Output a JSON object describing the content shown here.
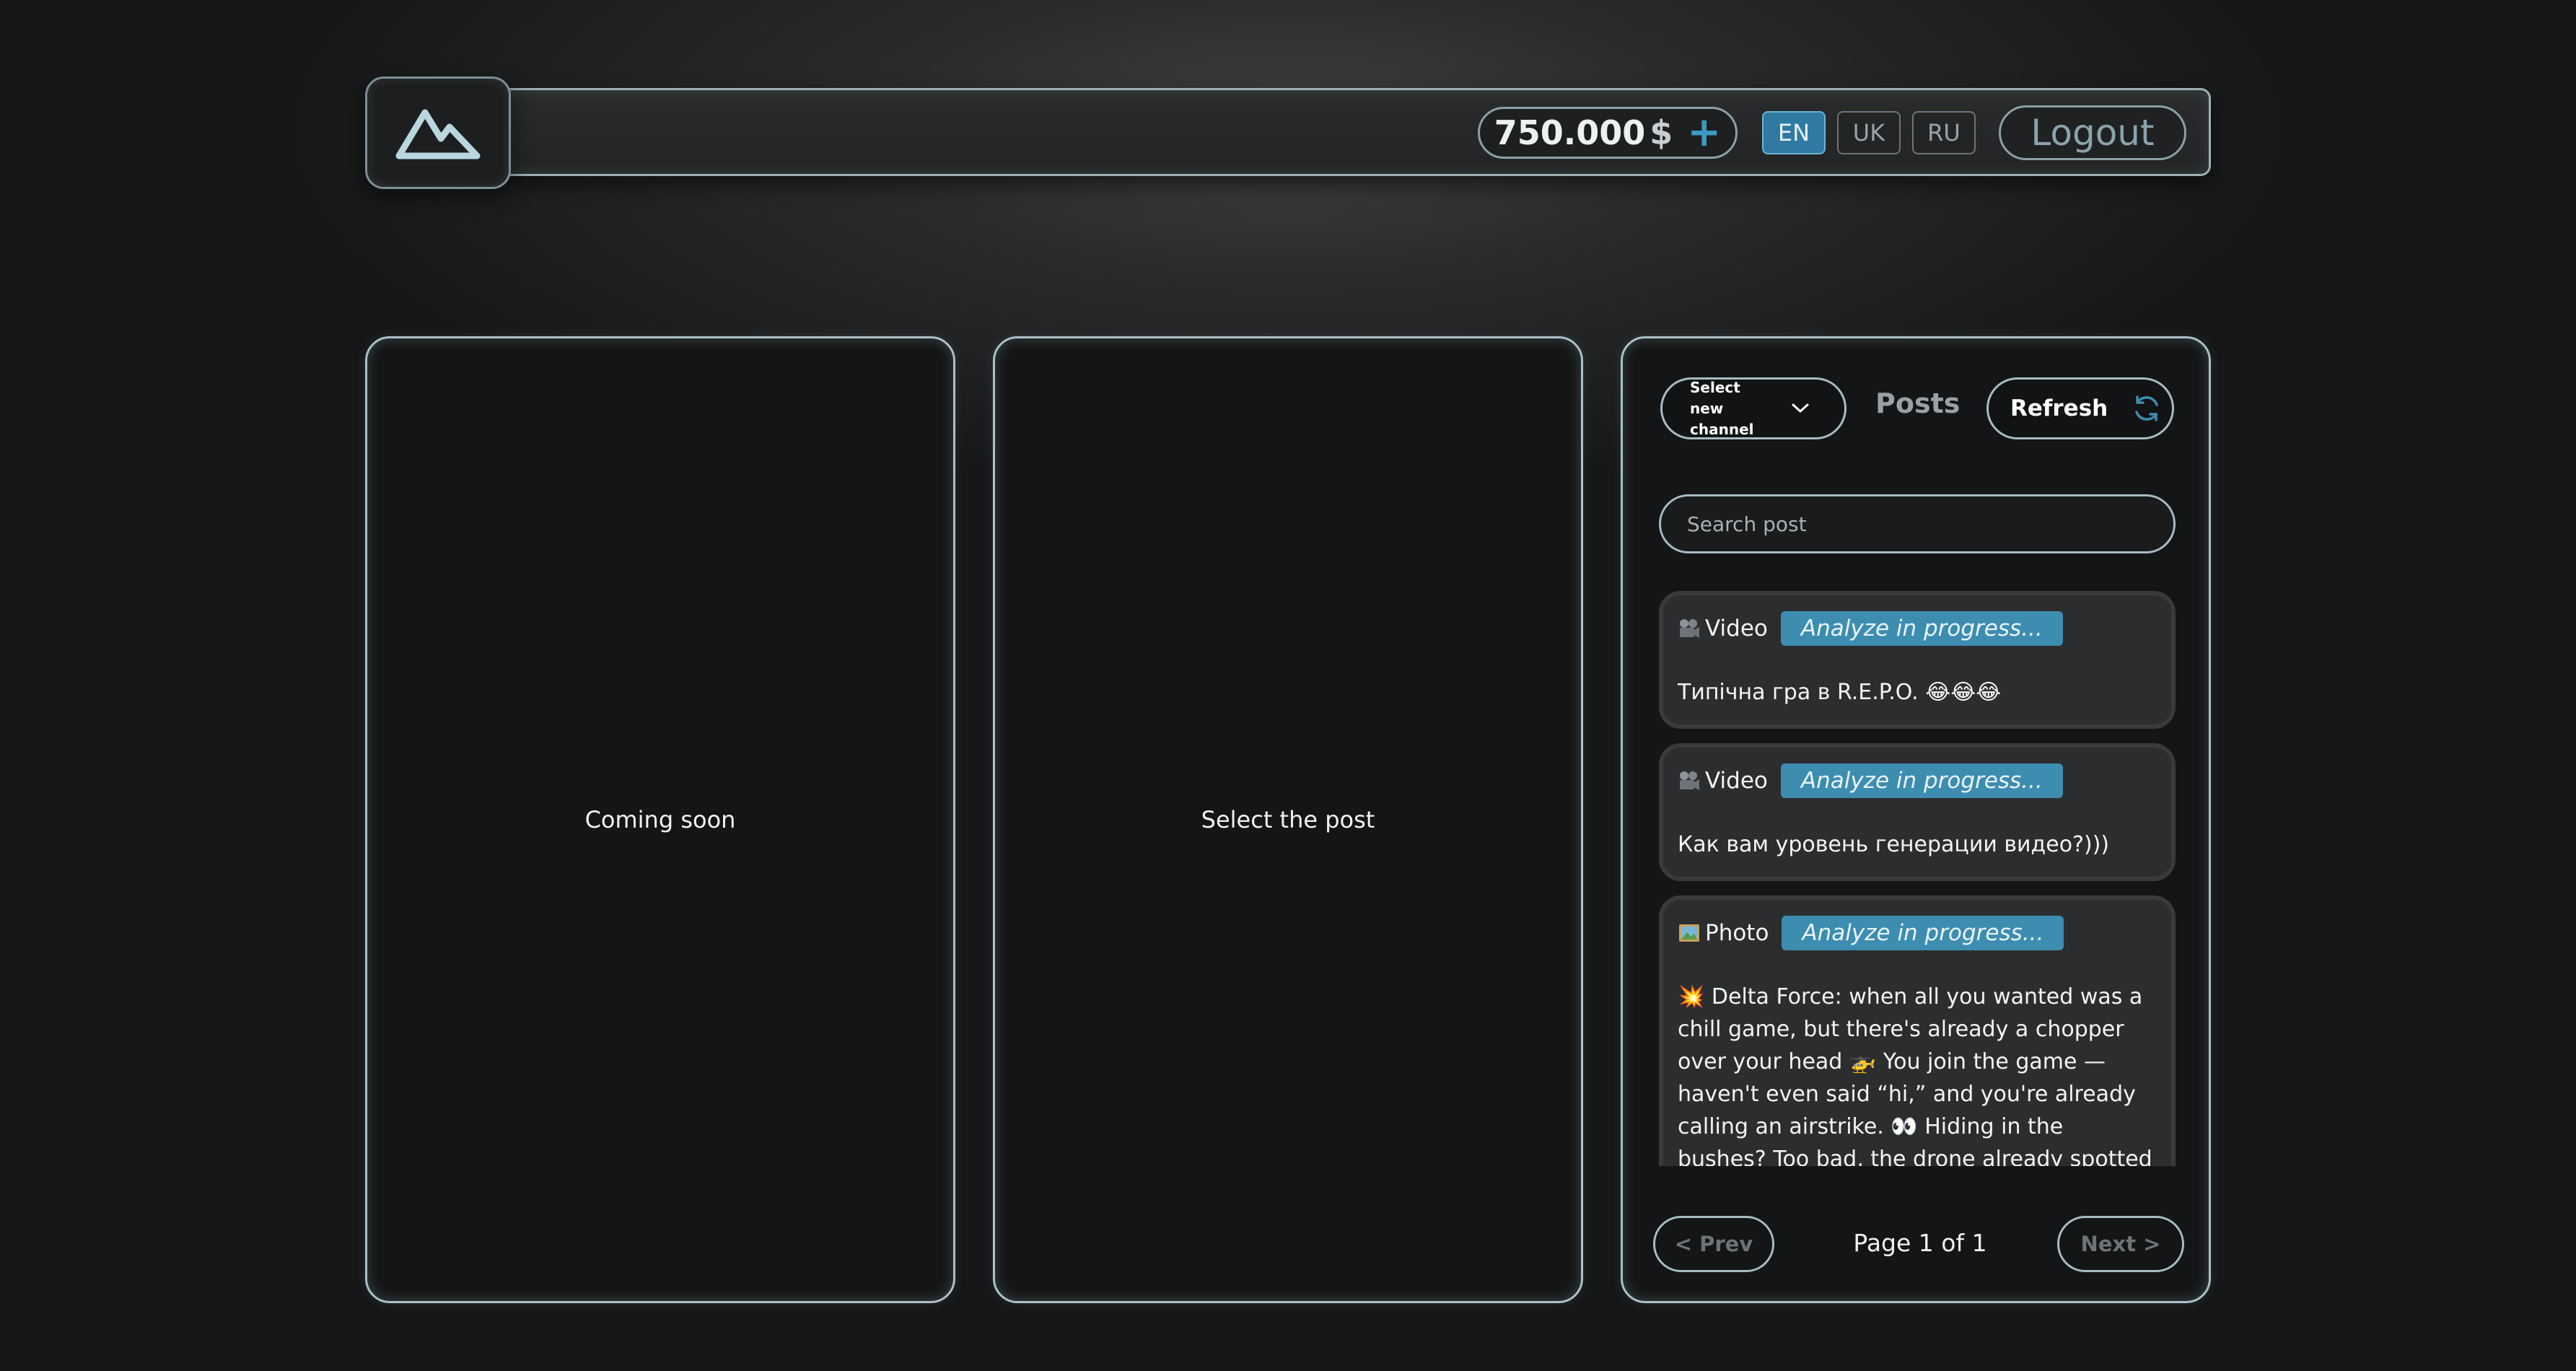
{
  "header": {
    "balance_amount": "750.000",
    "balance_currency": "$",
    "add_funds_symbol": "+",
    "languages": [
      {
        "code": "EN",
        "active": true
      },
      {
        "code": "UK",
        "active": false
      },
      {
        "code": "RU",
        "active": false
      }
    ],
    "logout_label": "Logout"
  },
  "left_panel": {
    "text": "Coming soon"
  },
  "middle_panel": {
    "text": "Select the post"
  },
  "posts_panel": {
    "channel_select_label": "Select new channel",
    "title": "Posts",
    "refresh_label": "Refresh",
    "search_placeholder": "Search post",
    "posts": [
      {
        "type_icon": "film-camera",
        "type": "Video",
        "status": "Analyze in progress...",
        "text": "Типічна гра в R.E.P.O. 😂😂😂"
      },
      {
        "type_icon": "film-camera",
        "type": "Video",
        "status": "Analyze in progress...",
        "text": "Как вам уровень генерации видео?)))"
      },
      {
        "type_icon": "picture-frame",
        "type": "Photo",
        "status": "Analyze in progress...",
        "text": "💥 Delta Force: when all you wanted was a chill game, but there's already a chopper over your head 🚁 You join the game — haven't even said “hi,” and you're already calling an airstrike. 👀 Hiding in the bushes? Too bad, the drone already spotted you."
      }
    ],
    "prev_label": "< Prev",
    "page_label": "Page 1 of 1",
    "next_label": "Next >"
  },
  "colors": {
    "accent": "#3d8db0",
    "panel_border": "#a9c1c7",
    "panel_bg": "#141516"
  }
}
